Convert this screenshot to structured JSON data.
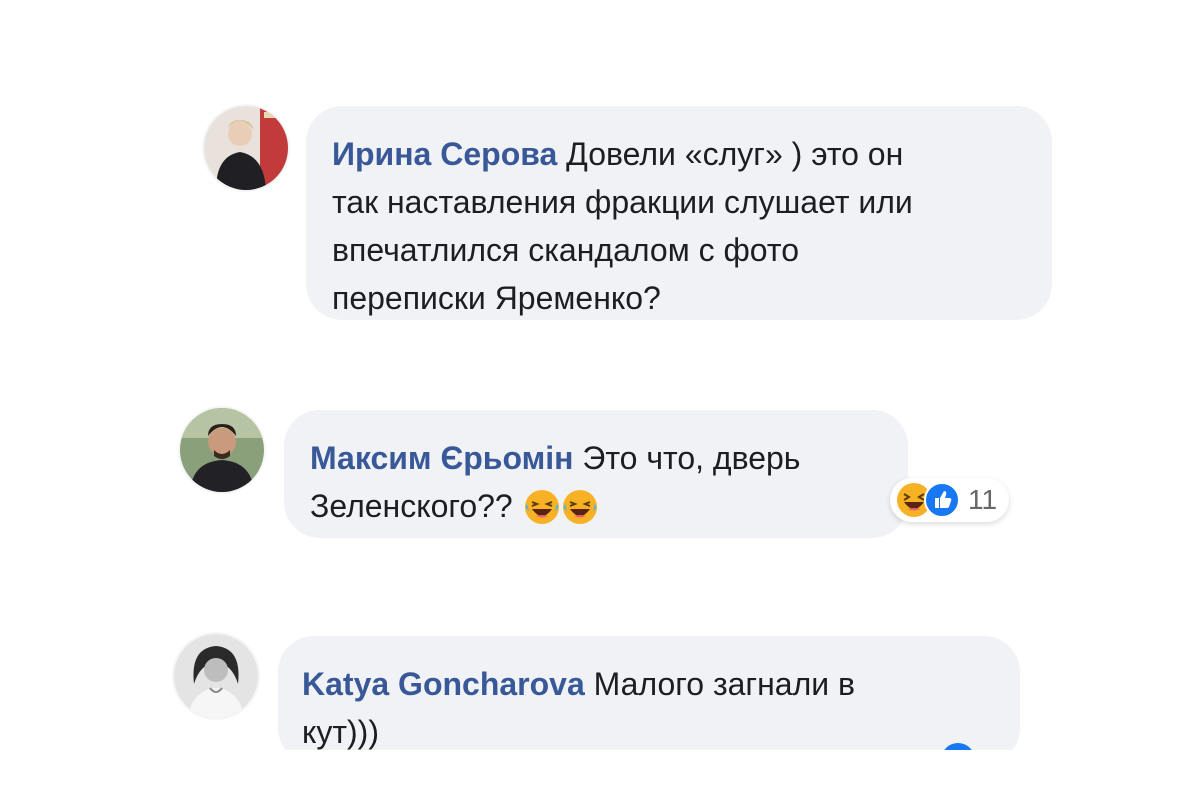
{
  "comments": [
    {
      "author": "Ирина Серова",
      "lines": [
        "Довели «слуг» ) это он",
        "так наставления фракции слушает или",
        "впечатлился скандалом с фото",
        "переписки Яременко?"
      ]
    },
    {
      "author": "Максим Єрьомін",
      "lines": [
        "Это что, дверь",
        "Зеленского??"
      ],
      "inline_emoji": [
        "laughing-face",
        "laughing-face"
      ],
      "reactions": {
        "icons": [
          "haha-reaction",
          "like-reaction"
        ],
        "count": "11"
      }
    },
    {
      "author": "Katya Goncharova",
      "lines": [
        "Малого загнали в",
        "кут)))"
      ]
    }
  ],
  "colors": {
    "bubble": "#f0f2f5",
    "author": "#385898",
    "text": "#1c1e21",
    "like": "#1877f2",
    "haha": "#f7b125"
  }
}
